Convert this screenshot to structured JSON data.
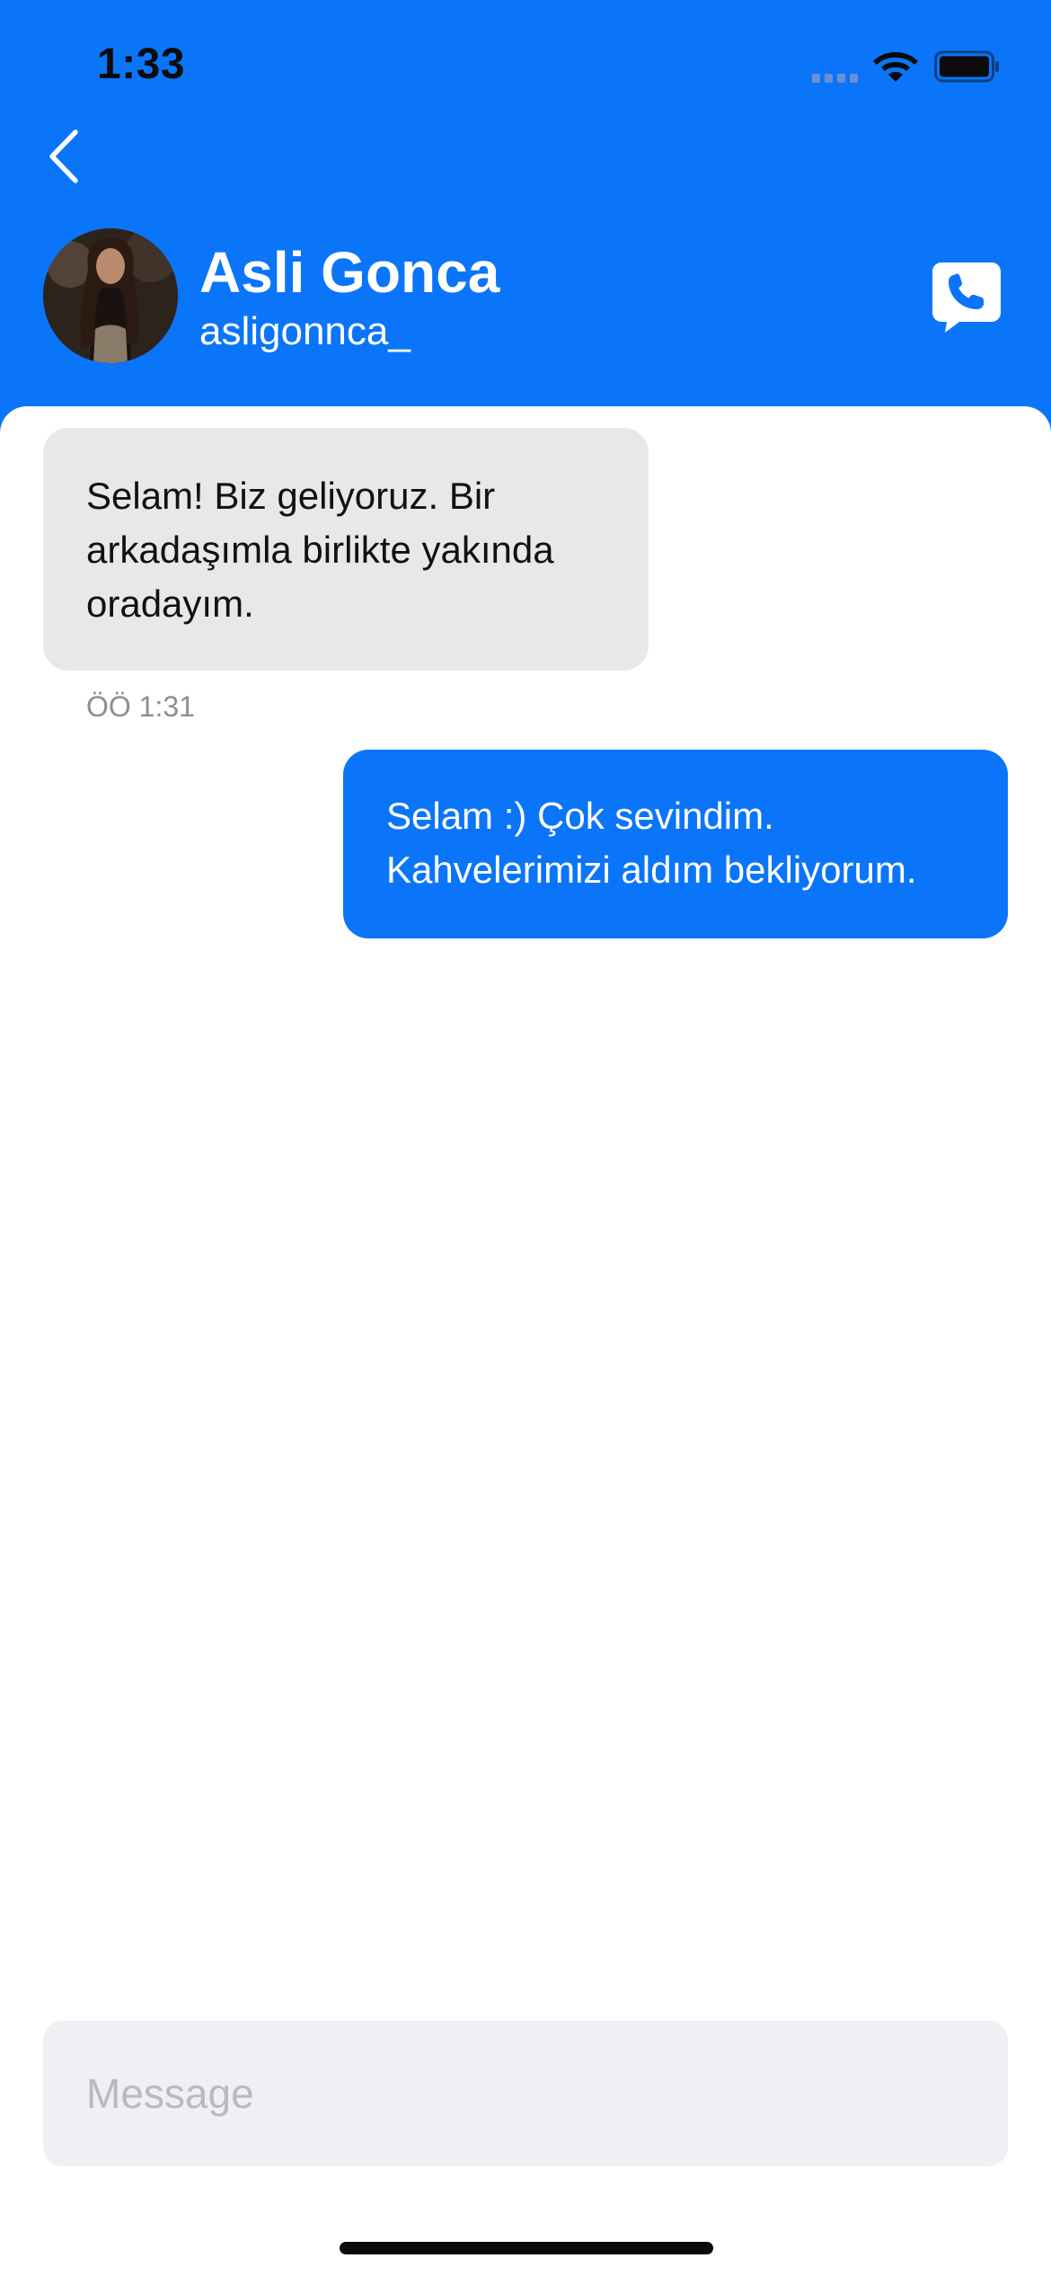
{
  "status_bar": {
    "time": "1:33"
  },
  "header": {
    "contact_name": "Asli Gonca",
    "username": "asligonnca_",
    "back_icon": "chevron-left-icon",
    "call_icon": "phone-bubble-icon"
  },
  "messages": [
    {
      "direction": "incoming",
      "text": "Selam! Biz geliyoruz. Bir arkadaşımla birlikte yakında oradayım.",
      "time": "ÖÖ 1:31"
    },
    {
      "direction": "outgoing",
      "text": "Selam :) Çok sevindim. Kahvelerimizi aldım bekliyorum."
    }
  ],
  "composer": {
    "placeholder": "Message",
    "value": ""
  },
  "colors": {
    "accent": "#0a75f9",
    "incoming_bubble": "#e8e8e8",
    "input_background": "#efeff4"
  }
}
